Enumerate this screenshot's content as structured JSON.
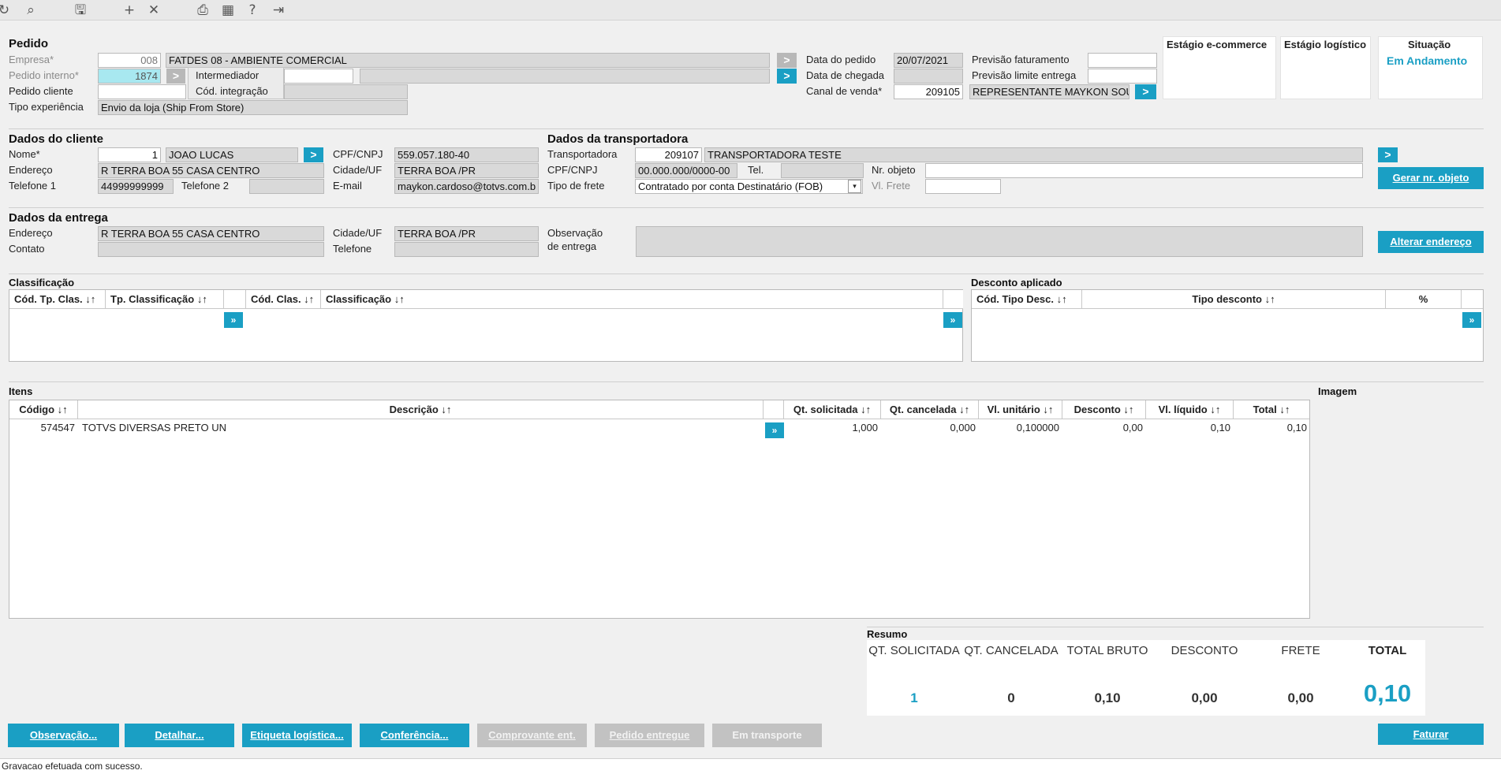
{
  "toolbar": {
    "icons": [
      "refresh-icon",
      "search-icon",
      "save-icon",
      "add-icon",
      "close-icon",
      "print-icon",
      "calendar-icon",
      "help-icon",
      "exit-icon"
    ],
    "glyphs": [
      "↻",
      "⌕",
      "🖫",
      "+",
      "✕",
      "⎙",
      "▦",
      "?",
      "⇥"
    ]
  },
  "pedido": {
    "title": "Pedido",
    "empresa_label": "Empresa*",
    "empresa_code": "008",
    "empresa_name": "FATDES 08 - AMBIENTE COMERCIAL",
    "pedido_interno_label": "Pedido interno*",
    "pedido_interno_value": "1874",
    "pedido_cliente_label": "Pedido cliente",
    "tipo_experiencia_label": "Tipo experiência",
    "tipo_experiencia_value": "Envio da loja (Ship From Store)",
    "popup": {
      "intermediador": "Intermediador",
      "cod_integracao": "Cód. integração"
    },
    "data_pedido_label": "Data do pedido",
    "data_pedido_value": "20/07/2021",
    "data_chegada_label": "Data de chegada",
    "canal_venda_label": "Canal de venda*",
    "canal_venda_code": "209105",
    "canal_venda_name": "REPRESENTANTE MAYKON SOU",
    "previsao_faturamento_label": "Previsão faturamento",
    "previsao_limite_label": "Previsão limite entrega",
    "arrow": ">"
  },
  "estagios": {
    "ecommerce_label": "Estágio e-commerce",
    "logistico_label": "Estágio logístico",
    "situacao_label": "Situação",
    "situacao_value": "Em Andamento"
  },
  "cliente": {
    "title": "Dados do cliente",
    "nome_label": "Nome*",
    "nome_code": "1",
    "nome_value": "JOAO LUCAS",
    "endereco_label": "Endereço",
    "endereco_value": "R TERRA BOA 55 CASA CENTRO",
    "telefone1_label": "Telefone 1",
    "telefone1_value": "44999999999",
    "telefone2_label": "Telefone 2",
    "cpf_label": "CPF/CNPJ",
    "cpf_value": "559.057.180-40",
    "cidade_label": "Cidade/UF",
    "cidade_value": "TERRA BOA /PR",
    "email_label": "E-mail",
    "email_value": "maykon.cardoso@totvs.com.b"
  },
  "transportadora": {
    "title": "Dados da transportadora",
    "transportadora_label": "Transportadora",
    "transportadora_code": "209107",
    "transportadora_name": "TRANSPORTADORA TESTE",
    "cpf_label": "CPF/CNPJ",
    "cpf_value": "00.000.000/0000-00",
    "tel_label": "Tel.",
    "tipo_frete_label": "Tipo de frete",
    "tipo_frete_value": "Contratado por conta Destinatário (FOB)",
    "nr_objeto_label": "Nr. objeto",
    "vl_frete_label": "Vl. Frete",
    "gerar_button": "Gerar nr. objeto"
  },
  "entrega": {
    "title": "Dados da entrega",
    "endereco_label": "Endereço",
    "endereco_value": "R TERRA BOA 55 CASA CENTRO",
    "contato_label": "Contato",
    "cidade_label": "Cidade/UF",
    "cidade_value": "TERRA BOA /PR",
    "telefone_label": "Telefone",
    "observacao_label1": "Observação",
    "observacao_label2": "de entrega",
    "alterar_button": "Alterar endereço"
  },
  "classificacao": {
    "title": "Classificação",
    "headers": [
      "Cód. Tp. Clas. ↓↑",
      "Tp. Classificação ↓↑",
      "Cód. Clas. ↓↑",
      "Classificação ↓↑"
    ],
    "arrow": "»"
  },
  "desconto": {
    "title": "Desconto aplicado",
    "headers": [
      "Cód. Tipo Desc. ↓↑",
      "Tipo desconto ↓↑",
      "%"
    ],
    "arrow": "»"
  },
  "itens": {
    "title": "Itens",
    "headers": [
      "Código ↓↑",
      "Descrição ↓↑",
      "Qt. solicitada ↓↑",
      "Qt. cancelada ↓↑",
      "Vl. unitário ↓↑",
      "Desconto ↓↑",
      "Vl. líquido ↓↑",
      "Total ↓↑"
    ],
    "rows": [
      {
        "codigo": "574547",
        "descricao": "TOTVS DIVERSAS PRETO UN",
        "qt_solicitada": "1,000",
        "qt_cancelada": "0,000",
        "vl_unitario": "0,100000",
        "desconto": "0,00",
        "vl_liquido": "0,10",
        "total": "0,10"
      }
    ],
    "arrow": "»"
  },
  "imagem": {
    "title": "Imagem"
  },
  "resumo": {
    "title": "Resumo",
    "labels": [
      "QT. SOLICITADA",
      "QT. CANCELADA",
      "TOTAL BRUTO",
      "DESCONTO",
      "FRETE",
      "TOTAL"
    ],
    "values": [
      "1",
      "0",
      "0,10",
      "0,00",
      "0,00",
      "0,10"
    ]
  },
  "buttons": {
    "observacao": "Observação...",
    "detalhar": "Detalhar...",
    "etiqueta": "Etiqueta logística...",
    "conferencia": "Conferência...",
    "comprovante": "Comprovante ent.",
    "pedido_entregue": "Pedido entregue",
    "em_transporte": "Em transporte",
    "faturar": "Faturar"
  },
  "status": {
    "message": "Gravacao efetuada com sucesso."
  },
  "colors": {
    "accent": "#1a9fc4",
    "highlight": "#a8e8f0",
    "disabled": "#c2c2c2"
  }
}
